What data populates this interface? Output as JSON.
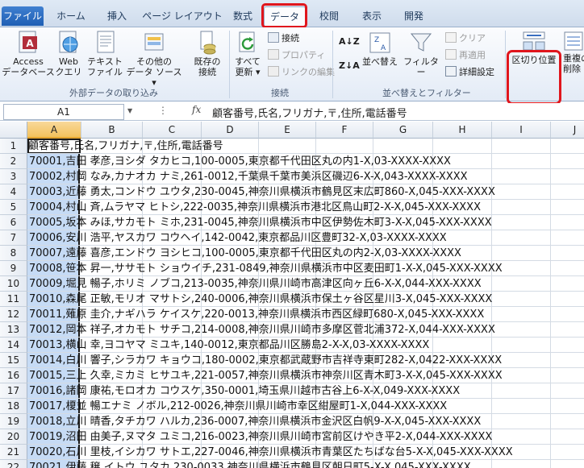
{
  "tabs": [
    "ファイル",
    "ホーム",
    "挿入",
    "ページ レイアウト",
    "数式",
    "データ",
    "校閲",
    "表示",
    "開発"
  ],
  "ribbon": {
    "access_l1": "Access",
    "access_l2": "データベース",
    "web_l1": "Web",
    "web_l2": "クエリ",
    "text_l1": "テキスト",
    "text_l2": "ファイル",
    "other_l1": "その他の",
    "other_l2": "データ ソース",
    "existing_l1": "既存の",
    "existing_l2": "接続",
    "refresh_l1": "すべて",
    "refresh_l2": "更新",
    "connections": "接続",
    "properties": "プロパティ",
    "edit_links": "リンクの編集",
    "sort": "並べ替え",
    "filter": "フィルター",
    "clear": "クリア",
    "reapply": "再適用",
    "advanced": "詳細設定",
    "text_to_columns": "区切り位置",
    "dup_l1": "重複の",
    "dup_l2": "削除",
    "group_external": "外部データの取り込み",
    "group_connections": "接続",
    "group_sort_filter": "並べ替えとフィルター"
  },
  "formula_bar": {
    "name_box": "A1",
    "fx": "fx",
    "content": "顧客番号,氏名,フリガナ,〒,住所,電話番号"
  },
  "columns": [
    "A",
    "B",
    "C",
    "D",
    "E",
    "F",
    "G",
    "H",
    "I",
    "J"
  ],
  "rows": [
    "1",
    "2",
    "3",
    "4",
    "5",
    "6",
    "7",
    "8",
    "9",
    "10",
    "11",
    "12",
    "13",
    "14",
    "15",
    "16",
    "17",
    "18",
    "19",
    "20",
    "21",
    "22"
  ],
  "cells": [
    "顧客番号,氏名,フリガナ,〒,住所,電話番号",
    "70001,吉田 孝彦,ヨシダ タカヒコ,100-0005,東京都千代田区丸の内1-X,03-XXXX-XXXX",
    "70002,村岡 なみ,カナオカ ナミ,261-0012,千葉県千葉市美浜区磯辺6-X-X,043-XXXX-XXXX",
    "70003,近藤 勇太,コンドウ ユウタ,230-0045,神奈川県横浜市鶴見区末広町860-X,045-XXX-XXXX",
    "70004,村山 斉,ムラヤマ ヒトシ,222-0035,神奈川県横浜市港北区鳥山町2-X-X,045-XXX-XXXX",
    "70005,坂本 みほ,サカモト ミホ,231-0045,神奈川県横浜市中区伊勢佐木町3-X-X,045-XXX-XXXX",
    "70006,安川 浩平,ヤスカワ コウヘイ,142-0042,東京都品川区豊町32-X,03-XXXX-XXXX",
    "70007,遠藤 喜彦,エンドウ ヨシヒコ,100-0005,東京都千代田区丸の内2-X,03-XXXX-XXXX",
    "70008,笹本 昇一,ササモト ショウイチ,231-0849,神奈川県横浜市中区麦田町1-X-X,045-XXX-XXXX",
    "70009,堀見 暢子,ホリミ ノブコ,213-0035,神奈川県川崎市高津区向ヶ丘6-X-X,044-XXX-XXXX",
    "70010,森尾 正敏,モリオ マサトシ,240-0006,神奈川県横浜市保土ヶ谷区星川3-X,045-XXX-XXXX",
    "70011,薙原 圭介,ナギハラ ケイスケ,220-0013,神奈川県横浜市西区緑町680-X,045-XXX-XXXX",
    "70012,岡本 祥子,オカモト サチコ,214-0008,神奈川県川崎市多摩区菅北浦372-X,044-XXX-XXXX",
    "70013,横山 幸,ヨコヤマ ミユキ,140-0012,東京都品川区勝島2-X-X,03-XXXX-XXXX",
    "70014,白川 響子,シラカワ キョウコ,180-0002,東京都武蔵野市吉祥寺東町282-X,0422-XXX-XXXX",
    "70015,三上 久幸,ミカミ ヒサユキ,221-0057,神奈川県横浜市神奈川区青木町3-X-X,045-XXX-XXXX",
    "70016,諸岡 康祐,モロオカ コウスケ,350-0001,埼玉県川越市古谷上6-X-X,049-XXX-XXXX",
    "70017,榎並 暢エナミ ノボル,212-0026,神奈川県川崎市幸区紺屋町1-X,044-XXX-XXXX",
    "70018,立川 晴香,タチカワ ハルカ,236-0007,神奈川県横浜市金沢区白帆9-X-X,045-XXX-XXXX",
    "70019,沼田 由美子,ヌマタ ユミコ,216-0023,神奈川県川崎市宮前区けやき平2-X,044-XXX-XXXX",
    "70020,石川 里枝,イシカワ サトエ,227-0046,神奈川県横浜市青葉区たちばな台5-X-X,045-XXX-XXXX",
    "70021,伊藤 穣,イトウ ユタカ,230-0033,神奈川県横浜市鶴見区朝日町5-X-X,045-XXX-XXXX"
  ],
  "colors": {
    "highlight": "#e0161d",
    "file_tab": "#2a67c0",
    "selection": "#c6dbf5"
  }
}
